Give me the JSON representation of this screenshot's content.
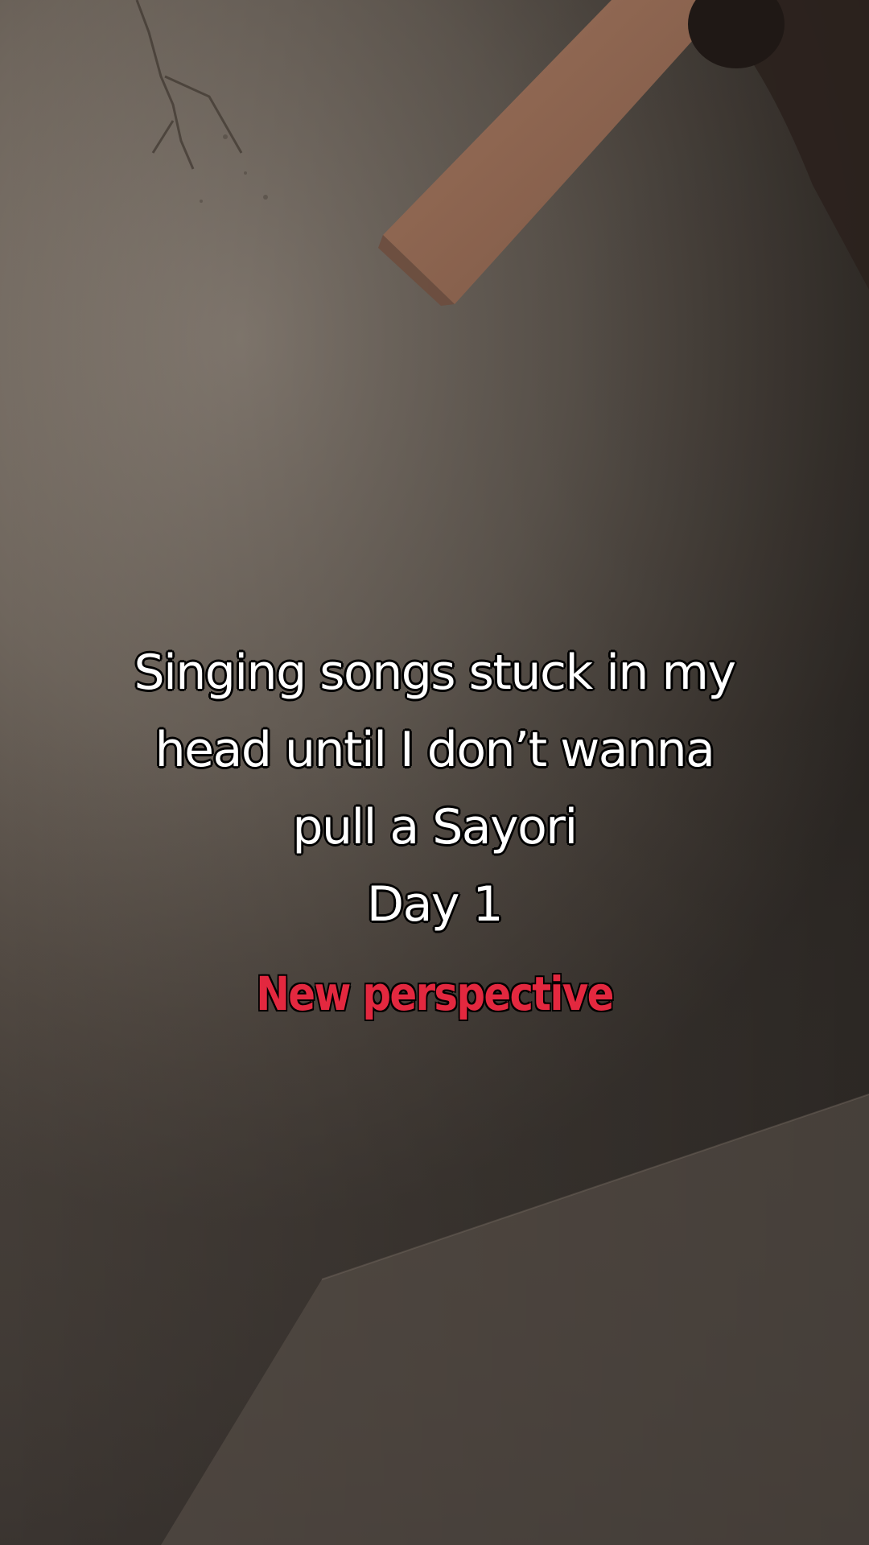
{
  "video": {
    "scene_description_icon": "ceiling-fan-blade-icon"
  },
  "caption": {
    "lines": [
      "Singing songs stuck in my",
      "head until I don’t wanna",
      "pull a Sayori",
      "Day 1"
    ],
    "subtitle": "New perspective"
  },
  "colors": {
    "caption_text": "#ffffff",
    "caption_outline": "#000000",
    "subtitle_text": "#e3283f"
  }
}
